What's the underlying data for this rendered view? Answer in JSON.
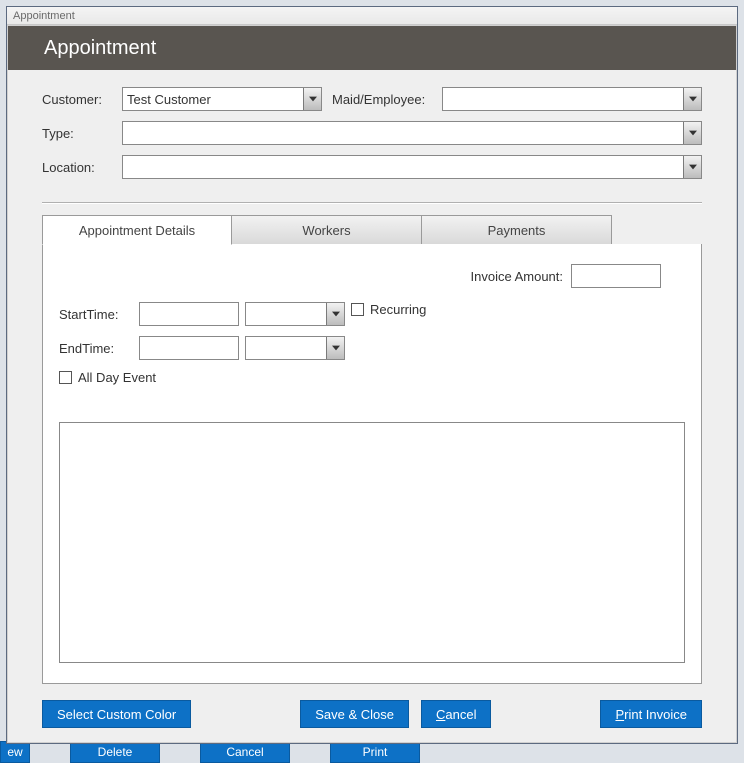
{
  "window": {
    "title": "Appointment"
  },
  "header": {
    "title": "Appointment"
  },
  "form": {
    "customer_label": "Customer:",
    "customer_value": "Test Customer",
    "maid_label": "Maid/Employee:",
    "maid_value": "",
    "type_label": "Type:",
    "type_value": "",
    "location_label": "Location:",
    "location_value": ""
  },
  "tabs": {
    "t1": "Appointment Details",
    "t2": "Workers",
    "t3": "Payments"
  },
  "details": {
    "invoice_label": "Invoice Amount:",
    "invoice_value": "",
    "start_label": "StartTime:",
    "start_date": "",
    "start_time": "",
    "recurring_label": "Recurring",
    "end_label": "EndTime:",
    "end_date": "",
    "end_time": "",
    "allday_label": "All Day Event",
    "notes": ""
  },
  "buttons": {
    "color": "Select Custom Color",
    "save": "Save & Close",
    "cancel": "Cancel",
    "print": "Print Invoice"
  },
  "bg": {
    "b1": "ew",
    "b2": "Delete",
    "b3": "Cancel",
    "b4": "Print"
  }
}
